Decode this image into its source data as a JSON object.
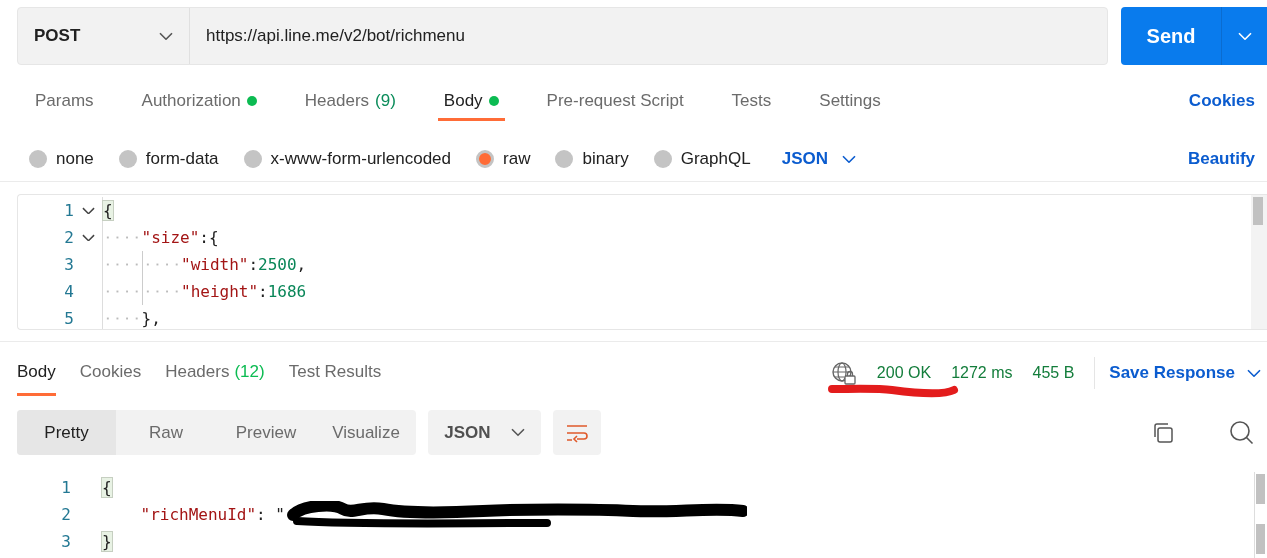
{
  "request": {
    "method": "POST",
    "url": "https://api.line.me/v2/bot/richmenu",
    "send": "Send"
  },
  "request_tabs": [
    {
      "label": "Params",
      "selected": false,
      "dot": false
    },
    {
      "label": "Authorization",
      "selected": false,
      "dot": true
    },
    {
      "label": "Headers",
      "count": "(9)",
      "selected": false,
      "dot": false
    },
    {
      "label": "Body",
      "selected": true,
      "dot": true
    },
    {
      "label": "Pre-request Script",
      "selected": false,
      "dot": false
    },
    {
      "label": "Tests",
      "selected": false,
      "dot": false
    },
    {
      "label": "Settings",
      "selected": false,
      "dot": false
    }
  ],
  "cookies_link": "Cookies",
  "body_types": [
    {
      "label": "none",
      "selected": false
    },
    {
      "label": "form-data",
      "selected": false
    },
    {
      "label": "x-www-form-urlencoded",
      "selected": false
    },
    {
      "label": "raw",
      "selected": true
    },
    {
      "label": "binary",
      "selected": false
    },
    {
      "label": "GraphQL",
      "selected": false
    }
  ],
  "body_format": "JSON",
  "beautify": "Beautify",
  "editor_lines": [
    {
      "number": "1",
      "fold": true,
      "tokens": [
        {
          "kind": "brace-match",
          "text": "{"
        }
      ]
    },
    {
      "number": "2",
      "fold": true,
      "tokens": [
        {
          "kind": "ws"
        },
        {
          "kind": "key",
          "text": "\"size\""
        },
        {
          "kind": "punct",
          "text": ":{"
        }
      ]
    },
    {
      "number": "3",
      "fold": false,
      "tokens": [
        {
          "kind": "ws"
        },
        {
          "kind": "guide"
        },
        {
          "kind": "key",
          "text": "\"width\""
        },
        {
          "kind": "punct",
          "text": ":"
        },
        {
          "kind": "number",
          "text": "2500"
        },
        {
          "kind": "punct",
          "text": ","
        }
      ]
    },
    {
      "number": "4",
      "fold": false,
      "tokens": [
        {
          "kind": "ws"
        },
        {
          "kind": "guide"
        },
        {
          "kind": "key",
          "text": "\"height\""
        },
        {
          "kind": "punct",
          "text": ":"
        },
        {
          "kind": "number",
          "text": "1686"
        }
      ]
    },
    {
      "number": "5",
      "fold": false,
      "tokens": [
        {
          "kind": "ws"
        },
        {
          "kind": "punct",
          "text": "},"
        }
      ]
    }
  ],
  "response_tabs": [
    {
      "label": "Body",
      "selected": true
    },
    {
      "label": "Cookies",
      "selected": false
    },
    {
      "label": "Headers",
      "count": "(12)",
      "selected": false
    },
    {
      "label": "Test Results",
      "selected": false
    }
  ],
  "status": "200 OK",
  "time": "1272 ms",
  "size": "455 B",
  "save_response": "Save Response",
  "view_modes": [
    {
      "label": "Pretty",
      "selected": true
    },
    {
      "label": "Raw",
      "selected": false
    },
    {
      "label": "Preview",
      "selected": false
    },
    {
      "label": "Visualize",
      "selected": false
    }
  ],
  "response_format": "JSON",
  "response_lines": [
    {
      "number": "1",
      "tokens": [
        {
          "kind": "brace-match",
          "text": "{"
        }
      ]
    },
    {
      "number": "2",
      "tokens": [
        {
          "kind": "space"
        },
        {
          "kind": "key",
          "text": "\"richMenuId\""
        },
        {
          "kind": "punct",
          "text": ": \""
        },
        {
          "kind": "redacted"
        }
      ]
    },
    {
      "number": "3",
      "tokens": [
        {
          "kind": "brace-match",
          "text": "}"
        }
      ]
    }
  ]
}
